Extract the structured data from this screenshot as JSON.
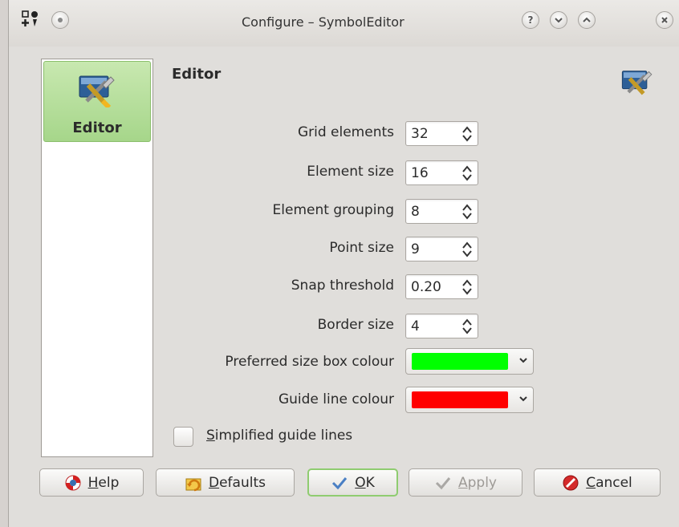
{
  "window": {
    "title": "Configure – SymbolEditor",
    "titlebar_buttons": [
      "help-icon",
      "shade-icon",
      "minimize-icon",
      "maximize-icon",
      "close-icon"
    ]
  },
  "sidebar": {
    "items": [
      {
        "label": "Editor",
        "icon": "editor-tools-icon",
        "selected": true
      }
    ]
  },
  "page": {
    "title": "Editor",
    "icon": "editor-tools-icon"
  },
  "form": {
    "grid_elements": {
      "label": "Grid elements",
      "value": "32"
    },
    "element_size": {
      "label": "Element size",
      "value": "16"
    },
    "element_grouping": {
      "label": "Element grouping",
      "value": "8"
    },
    "point_size": {
      "label": "Point size",
      "value": "9"
    },
    "snap_threshold": {
      "label": "Snap threshold",
      "value": "0.20"
    },
    "border_size": {
      "label": "Border size",
      "value": "4"
    },
    "preferred_box_colour": {
      "label": "Preferred size box colour",
      "color": "#00ff00"
    },
    "guide_line_colour": {
      "label": "Guide line colour",
      "color": "#ff0000"
    },
    "simplified_guide_lines": {
      "label_first": "S",
      "label_rest": "implified guide lines",
      "checked": false
    }
  },
  "buttons": {
    "help": {
      "first": "H",
      "rest": "elp",
      "icon": "help-lifebuoy-icon"
    },
    "defaults": {
      "first": "D",
      "rest": "efaults",
      "icon": "defaults-icon"
    },
    "ok": {
      "first": "O",
      "rest": "K",
      "icon": "checkmark-icon"
    },
    "apply": {
      "first": "A",
      "rest": "pply",
      "icon": "checkmark-icon",
      "disabled": true
    },
    "cancel": {
      "first": "C",
      "rest": "ancel",
      "icon": "cancel-icon"
    }
  }
}
